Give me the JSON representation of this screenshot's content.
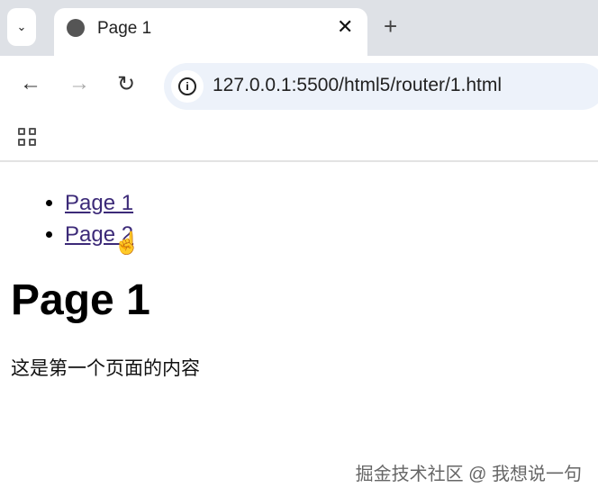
{
  "browser": {
    "tab_title": "Page 1",
    "url": "127.0.0.1:5500/html5/router/1.html"
  },
  "page": {
    "links": [
      "Page 1",
      "Page 2"
    ],
    "heading": "Page 1",
    "paragraph": "这是第一个页面的内容"
  },
  "watermark": "掘金技术社区 @ 我想说一句"
}
